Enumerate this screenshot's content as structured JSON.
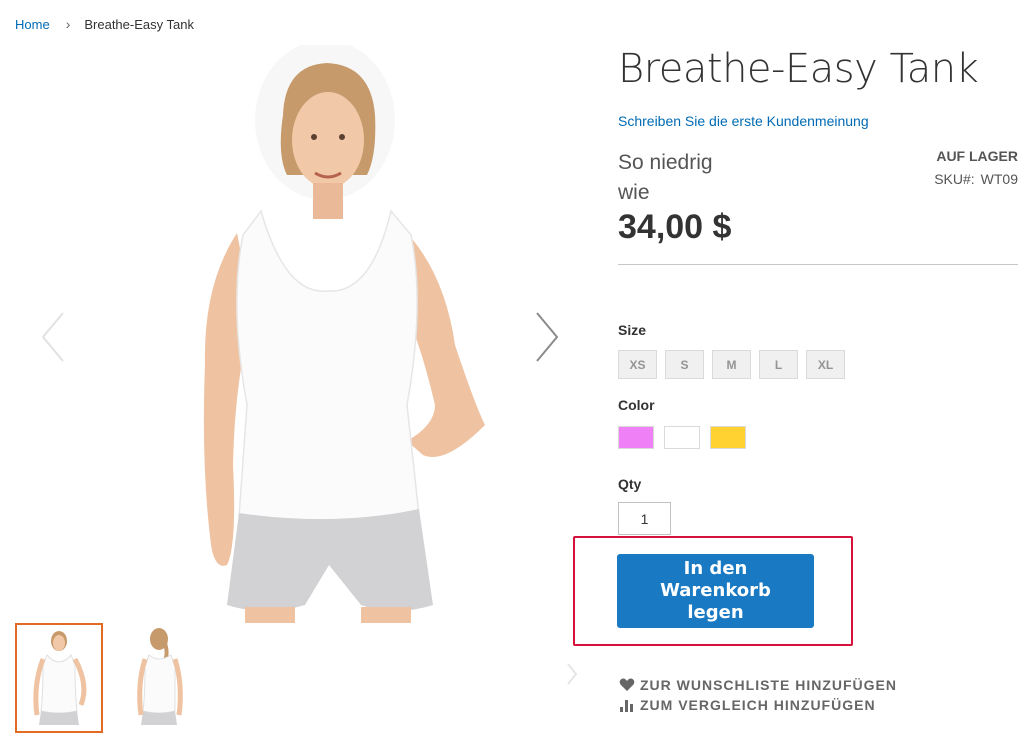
{
  "breadcrumb": {
    "home": "Home",
    "separator": "›",
    "current": "Breathe-Easy Tank"
  },
  "gallery": {
    "main_image": "woman-white-tank-top-front",
    "thumbnails": [
      "woman-white-tank-top-front",
      "woman-white-tank-top-back"
    ],
    "icons": {
      "prev": "chevron-left-icon",
      "next": "chevron-right-icon"
    }
  },
  "product": {
    "title": "Breathe-Easy Tank",
    "review_link": "Schreiben Sie die erste Kundenmeinung",
    "price_label": "So niedrig wie",
    "price": "34,00 $",
    "stock": "AUF LAGER",
    "sku_label": "SKU#:",
    "sku": "WT09"
  },
  "options": {
    "size_label": "Size",
    "sizes": [
      "XS",
      "S",
      "M",
      "L",
      "XL"
    ],
    "color_label": "Color",
    "colors": [
      "#ef80f5",
      "#ffffff",
      "#ffd231"
    ]
  },
  "qty": {
    "label": "Qty",
    "value": "1"
  },
  "cart": {
    "button_label": "In den Warenkorb legen"
  },
  "actions": {
    "wishlist": "ZUR WUNSCHLISTE HINZUFÜGEN",
    "compare": "ZUM VERGLEICH HINZUFÜGEN"
  },
  "colors": {
    "link": "#006bb4",
    "primary_button": "#1979c3",
    "highlight_border": "#d6113c",
    "active_thumb_border": "#e26a23"
  }
}
